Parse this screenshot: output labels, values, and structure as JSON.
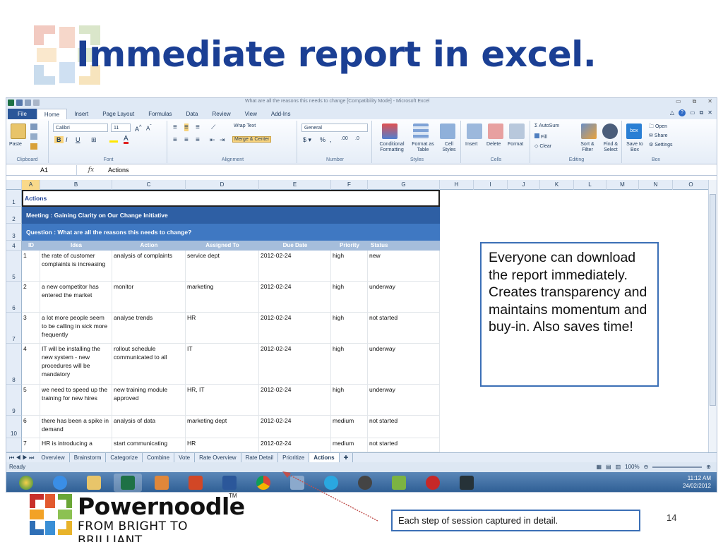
{
  "slide": {
    "title": "Immediate report in excel.",
    "callout_main": "Everyone can download the report immediately. Creates transparency and maintains momentum and buy-in. Also saves time!",
    "callout_footer": "Each step of session captured in detail.",
    "page_number": "14",
    "brand_name": "Powernoodle",
    "brand_tm": "TM",
    "brand_tagline": "FROM BRIGHT TO BRILLIANT"
  },
  "excel": {
    "window_title": "What are all the reasons this needs to change  [Compatibility Mode]  -  Microsoft Excel",
    "tabs": [
      "File",
      "Home",
      "Insert",
      "Page Layout",
      "Formulas",
      "Data",
      "Review",
      "View",
      "Add-Ins"
    ],
    "ribbon": {
      "clipboard": {
        "paste": "Paste",
        "label": "Clipboard"
      },
      "font": {
        "name": "Calibri",
        "size": "11",
        "label": "Font"
      },
      "alignment": {
        "wrap": "Wrap Text",
        "merge": "Merge & Center",
        "label": "Alignment"
      },
      "number": {
        "format": "General",
        "label": "Number"
      },
      "styles": {
        "conditional": "Conditional Formatting",
        "format_table": "Format as Table",
        "cell_styles": "Cell Styles",
        "label": "Styles"
      },
      "cells": {
        "insert": "Insert",
        "delete": "Delete",
        "format": "Format",
        "label": "Cells"
      },
      "editing": {
        "autosum": "AutoSum",
        "fill": "Fill",
        "clear": "Clear",
        "sort": "Sort & Filter",
        "find": "Find & Select",
        "label": "Editing"
      },
      "box": {
        "save": "Save to Box",
        "open": "Open",
        "share": "Share",
        "settings": "Settings",
        "label": "Box"
      }
    },
    "name_box": "A1",
    "fx": "fx",
    "formula": "Actions",
    "columns": [
      "A",
      "B",
      "C",
      "D",
      "E",
      "F",
      "G",
      "H",
      "I",
      "J",
      "K",
      "L",
      "M",
      "N",
      "O"
    ],
    "a1": "Actions",
    "meeting_banner": "Meeting : Gaining Clarity on Our Change Initiative",
    "question_banner": "Question :   What are all the reasons this needs to change?",
    "table_headers": [
      "ID",
      "Idea",
      "Action",
      "Assigned To",
      "Due Date",
      "Priority",
      "Status"
    ],
    "rows": [
      {
        "row": "5",
        "id": "1",
        "idea": "the rate of customer complaints is increasing",
        "action": "analysis of complaints",
        "assigned": "service dept",
        "due": "2012-02-24",
        "priority": "high",
        "status": "new"
      },
      {
        "row": "6",
        "id": "2",
        "idea": "a new competitor has entered the market",
        "action": "monitor",
        "assigned": "marketing",
        "due": "2012-02-24",
        "priority": "high",
        "status": "underway"
      },
      {
        "row": "7",
        "id": "3",
        "idea": "a lot more people seem to be calling in sick more frequently",
        "action": "analyse trends",
        "assigned": "HR",
        "due": "2012-02-24",
        "priority": "high",
        "status": "not started"
      },
      {
        "row": "8",
        "id": "4",
        "idea": "IT will be installing the new system - new procedures will be mandatory",
        "action": "rollout schedule communicated to all",
        "assigned": "IT",
        "due": "2012-02-24",
        "priority": "high",
        "status": "underway"
      },
      {
        "row": "9",
        "id": "5",
        "idea": "we need to speed up the training for new hires",
        "action": "new training module approved",
        "assigned": "HR, IT",
        "due": "2012-02-24",
        "priority": "high",
        "status": "underway"
      },
      {
        "row": "10",
        "id": "6",
        "idea": "there has been a spike in demand",
        "action": "analysis of data",
        "assigned": "marketing dept",
        "due": "2012-02-24",
        "priority": "medium",
        "status": "not started"
      },
      {
        "row": "",
        "id": "7",
        "idea": "HR is introducing a",
        "action": "start communicating",
        "assigned": "HR",
        "due": "2012-02-24",
        "priority": "medium",
        "status": "not started"
      }
    ],
    "row_labels_top": [
      "1",
      "2",
      "3",
      "4"
    ],
    "sheet_tabs": [
      "Overview",
      "Brainstorm",
      "Categorize",
      "Combine",
      "Vote",
      "Rate Overview",
      "Rate Detail",
      "Prioritize",
      "Actions"
    ],
    "status": "Ready",
    "zoom": "100%",
    "clock_time": "11:12 AM",
    "clock_date": "24/02/2012"
  },
  "colors": {
    "title_blue": "#1b3f94",
    "banner_dark": "#2e5fa4",
    "banner_light": "#3f78c2",
    "header_row": "#a5bddb",
    "callout_border": "#3b6fb6"
  }
}
